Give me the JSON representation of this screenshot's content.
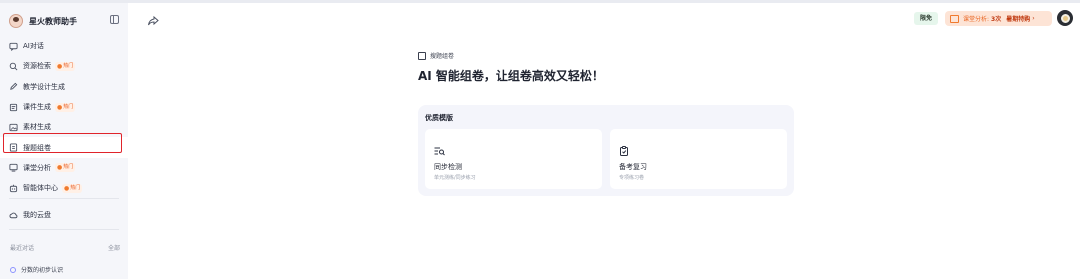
{
  "app": {
    "name": "星火教师助手"
  },
  "sidebar": {
    "items": [
      {
        "label": "AI对话",
        "icon": "chat-icon",
        "hot": false
      },
      {
        "label": "资源检索",
        "icon": "search-icon",
        "hot": true
      },
      {
        "label": "教学设计生成",
        "icon": "pencil-icon",
        "hot": false
      },
      {
        "label": "课件生成",
        "icon": "slides-icon",
        "hot": true
      },
      {
        "label": "素材生成",
        "icon": "image-icon",
        "hot": false
      },
      {
        "label": "搜题组卷",
        "icon": "paper-icon",
        "hot": false,
        "active": true
      },
      {
        "label": "课堂分析",
        "icon": "classroom-icon",
        "hot": true
      },
      {
        "label": "智能体中心",
        "icon": "agent-icon",
        "hot": true
      }
    ],
    "hot_label": "热门",
    "cloud": {
      "label": "我的云盘",
      "icon": "cloud-icon"
    },
    "recent": {
      "title": "最近对话",
      "all_label": "全部",
      "items": [
        {
          "label": "分数的初步认识"
        }
      ]
    }
  },
  "header": {
    "free_badge": "限免",
    "promo": {
      "text": "课堂分析:",
      "count": "3次",
      "cta": "暑期特购"
    }
  },
  "main": {
    "tool_tag": "搜题组卷",
    "headline": "AI 智能组卷，让组卷高效又轻松！",
    "panel": {
      "title": "优质模版",
      "cards": [
        {
          "title": "同步检测",
          "desc": "单元测练/同步练习",
          "icon": "search-list-icon"
        },
        {
          "title": "备考复习",
          "desc": "专项练习卷",
          "icon": "clipboard-check-icon"
        }
      ]
    }
  },
  "colors": {
    "accent": "#e8581c",
    "highlight": "#e0242b",
    "panel_bg": "#f4f5fb",
    "sidebar_bg": "#f5f6fa"
  }
}
